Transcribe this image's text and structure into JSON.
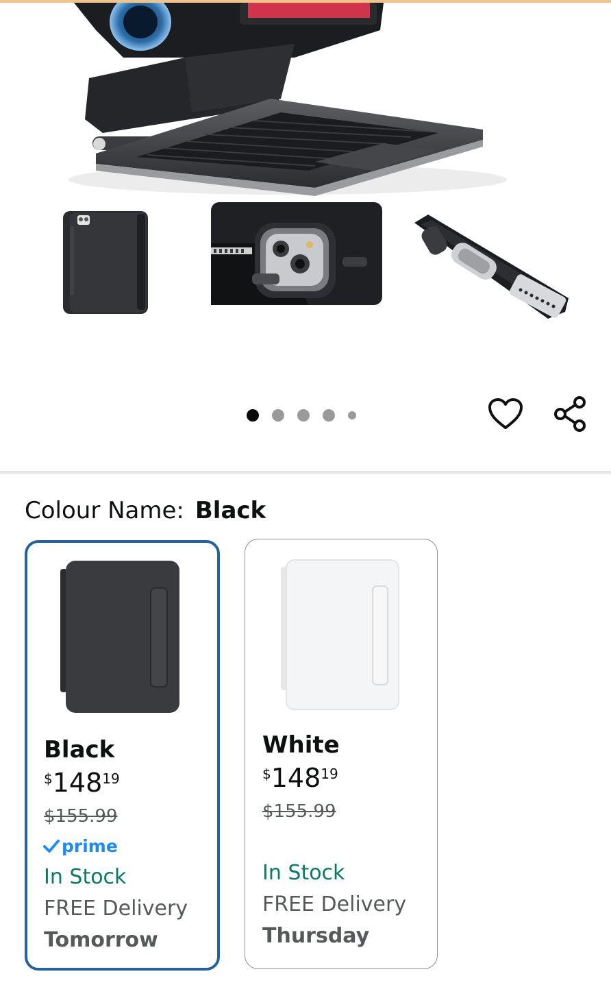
{
  "colour": {
    "label": "Colour Name:",
    "selected": "Black"
  },
  "gallery": {
    "dots_total": 5,
    "active_index": 0
  },
  "swatches": [
    {
      "name": "Black",
      "price_symbol": "$",
      "price_whole": "148",
      "price_fraction": "19",
      "list_price": "$155.99",
      "prime": "prime",
      "stock": "In Stock",
      "delivery": "FREE Delivery",
      "delivery_day": "Tomorrow",
      "selected": true
    },
    {
      "name": "White",
      "price_symbol": "$",
      "price_whole": "148",
      "price_fraction": "19",
      "list_price": "$155.99",
      "stock": "In Stock",
      "delivery": "FREE Delivery",
      "delivery_day": "Thursday",
      "selected": false
    }
  ],
  "colors": {
    "selected_border": "#2162a1",
    "in_stock": "#067d62",
    "prime": "#1a8bff"
  }
}
